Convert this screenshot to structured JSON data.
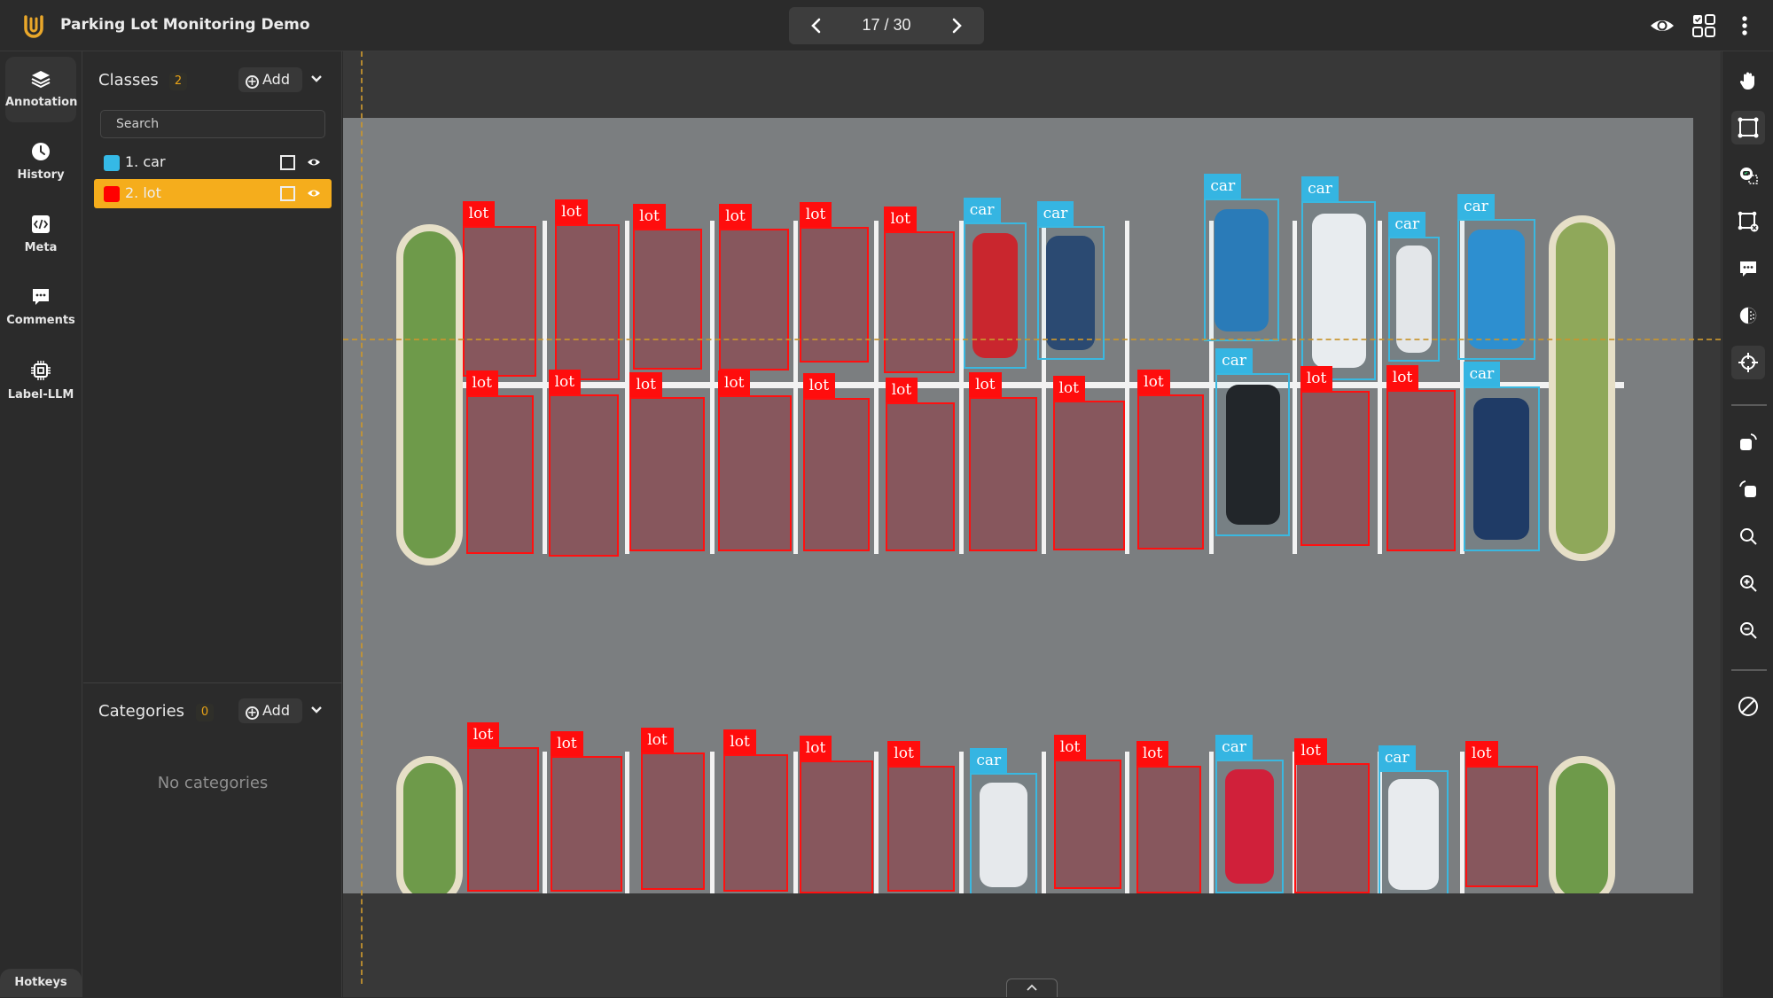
{
  "header": {
    "title": "Parking Lot Monitoring Demo",
    "pager": {
      "current": 17,
      "total": 30,
      "text": "17 / 30"
    },
    "icons": [
      "eye-icon",
      "grid-layout-icon",
      "more-vertical-icon"
    ]
  },
  "leftnav": {
    "items": [
      {
        "label": "Annotation",
        "icon": "layers-icon",
        "active": true
      },
      {
        "label": "History",
        "icon": "clock-icon",
        "active": false
      },
      {
        "label": "Meta",
        "icon": "code-icon",
        "active": false
      },
      {
        "label": "Comments",
        "icon": "comment-icon",
        "active": false
      },
      {
        "label": "Label-LLM",
        "icon": "chip-icon",
        "active": false
      }
    ],
    "hotkeys_label": "Hotkeys"
  },
  "classes": {
    "title": "Classes",
    "count": "2",
    "add_label": "Add",
    "search_placeholder": "Search",
    "items": [
      {
        "label": "1. car",
        "color": "#35b9e6",
        "selected": false
      },
      {
        "label": "2. lot",
        "color": "#ff0000",
        "selected": true
      }
    ]
  },
  "categories": {
    "title": "Categories",
    "count": "0",
    "add_label": "Add",
    "empty_text": "No categories"
  },
  "canvas": {
    "annotations": [
      "lot",
      "lot",
      "lot",
      "lot",
      "lot",
      "lot",
      "car",
      "car",
      "car",
      "car",
      "car",
      "car",
      "lot",
      "lot",
      "lot",
      "lot",
      "lot",
      "lot",
      "lot",
      "lot",
      "lot",
      "car",
      "lot",
      "lot",
      "car",
      "lot",
      "lot",
      "lot",
      "lot",
      "lot",
      "lot",
      "car",
      "lot",
      "lot",
      "car",
      "lot",
      "car",
      "lot"
    ],
    "class_colors": {
      "car": "#35b5e2",
      "lot": "#ff0d0d"
    },
    "collapse_icon": "chevron-up-icon"
  },
  "toolbar": {
    "tools": [
      {
        "name": "pan",
        "icon": "hand-icon",
        "active": false
      },
      {
        "name": "bounding-box",
        "icon": "bounding-box-icon",
        "active": true
      },
      {
        "name": "auto-annotate",
        "icon": "robot-box-icon",
        "active": false
      },
      {
        "name": "delete-box",
        "icon": "box-remove-icon",
        "active": false
      },
      {
        "name": "comment",
        "icon": "comment-icon",
        "active": false
      },
      {
        "name": "contrast",
        "icon": "contrast-icon",
        "active": false
      },
      {
        "name": "crosshair",
        "icon": "crosshair-icon",
        "active": true
      },
      {
        "name": "rotate-right",
        "icon": "rotate-right-icon",
        "active": false
      },
      {
        "name": "rotate-left",
        "icon": "rotate-left-icon",
        "active": false
      },
      {
        "name": "zoom-fit",
        "icon": "search-icon",
        "active": false
      },
      {
        "name": "zoom-in",
        "icon": "zoom-in-icon",
        "active": false
      },
      {
        "name": "zoom-out",
        "icon": "zoom-out-icon",
        "active": false
      },
      {
        "name": "hide-annotations",
        "icon": "disable-icon",
        "active": false
      }
    ]
  }
}
